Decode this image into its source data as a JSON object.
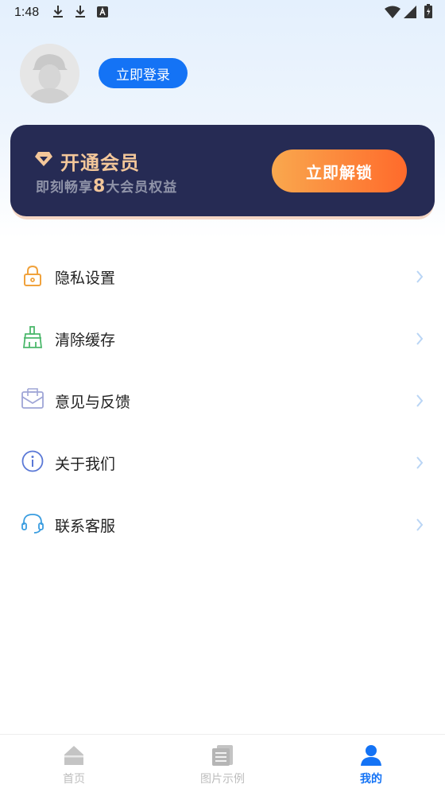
{
  "status_bar": {
    "time": "1:48"
  },
  "profile": {
    "login_label": "立即登录"
  },
  "vip": {
    "title": "开通会员",
    "subtitle_prefix": "即刻畅享",
    "subtitle_number": "8",
    "subtitle_suffix": "大会员权益",
    "unlock_label": "立即解锁",
    "gold_color": "#f3c79a",
    "card_color": "#262b54"
  },
  "menu": [
    {
      "label": "隐私设置",
      "icon": "lock-icon"
    },
    {
      "label": "清除缓存",
      "icon": "broom-icon"
    },
    {
      "label": "意见与反馈",
      "icon": "mail-icon"
    },
    {
      "label": "关于我们",
      "icon": "info-icon"
    },
    {
      "label": "联系客服",
      "icon": "headset-icon"
    }
  ],
  "tabs": [
    {
      "label": "首页",
      "icon": "home-icon",
      "active": false
    },
    {
      "label": "图片示例",
      "icon": "document-icon",
      "active": false
    },
    {
      "label": "我的",
      "icon": "user-icon",
      "active": true
    }
  ],
  "accent_color": "#1473f5"
}
